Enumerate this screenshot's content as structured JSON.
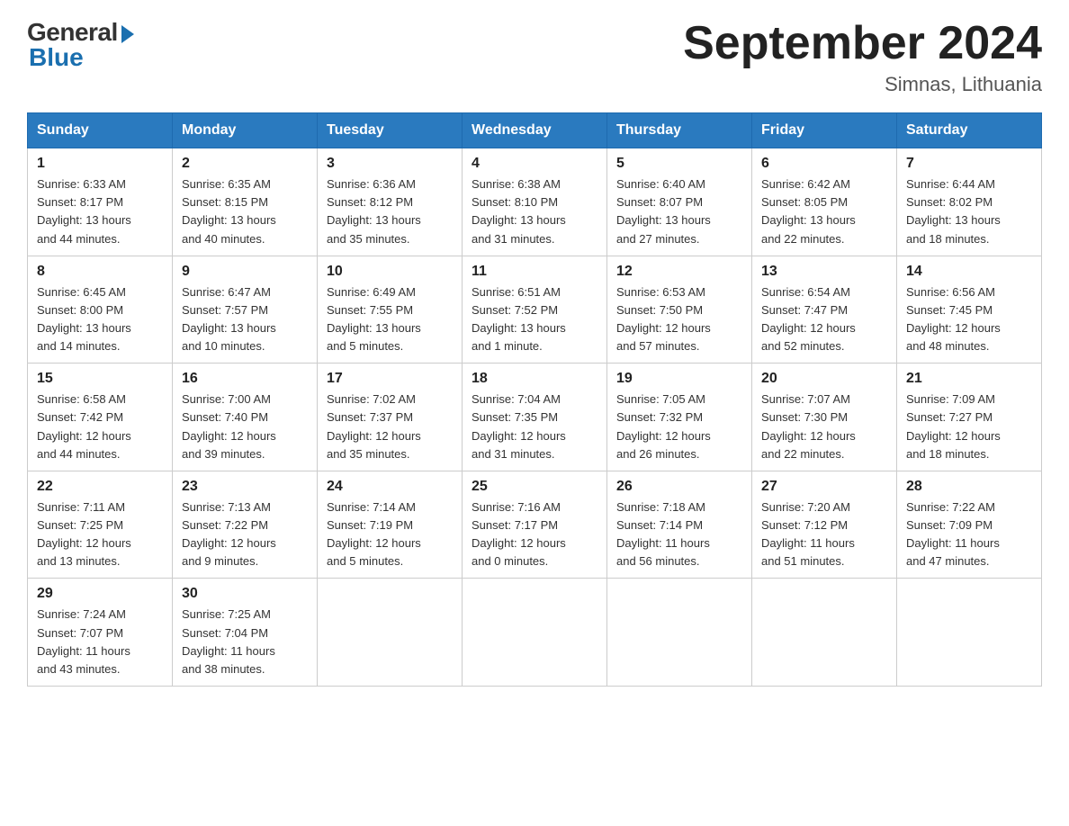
{
  "header": {
    "logo_general": "General",
    "logo_blue": "Blue",
    "month_title": "September 2024",
    "location": "Simnas, Lithuania"
  },
  "days_of_week": [
    "Sunday",
    "Monday",
    "Tuesday",
    "Wednesday",
    "Thursday",
    "Friday",
    "Saturday"
  ],
  "weeks": [
    [
      {
        "num": "1",
        "sunrise": "6:33 AM",
        "sunset": "8:17 PM",
        "daylight": "13 hours and 44 minutes."
      },
      {
        "num": "2",
        "sunrise": "6:35 AM",
        "sunset": "8:15 PM",
        "daylight": "13 hours and 40 minutes."
      },
      {
        "num": "3",
        "sunrise": "6:36 AM",
        "sunset": "8:12 PM",
        "daylight": "13 hours and 35 minutes."
      },
      {
        "num": "4",
        "sunrise": "6:38 AM",
        "sunset": "8:10 PM",
        "daylight": "13 hours and 31 minutes."
      },
      {
        "num": "5",
        "sunrise": "6:40 AM",
        "sunset": "8:07 PM",
        "daylight": "13 hours and 27 minutes."
      },
      {
        "num": "6",
        "sunrise": "6:42 AM",
        "sunset": "8:05 PM",
        "daylight": "13 hours and 22 minutes."
      },
      {
        "num": "7",
        "sunrise": "6:44 AM",
        "sunset": "8:02 PM",
        "daylight": "13 hours and 18 minutes."
      }
    ],
    [
      {
        "num": "8",
        "sunrise": "6:45 AM",
        "sunset": "8:00 PM",
        "daylight": "13 hours and 14 minutes."
      },
      {
        "num": "9",
        "sunrise": "6:47 AM",
        "sunset": "7:57 PM",
        "daylight": "13 hours and 10 minutes."
      },
      {
        "num": "10",
        "sunrise": "6:49 AM",
        "sunset": "7:55 PM",
        "daylight": "13 hours and 5 minutes."
      },
      {
        "num": "11",
        "sunrise": "6:51 AM",
        "sunset": "7:52 PM",
        "daylight": "13 hours and 1 minute."
      },
      {
        "num": "12",
        "sunrise": "6:53 AM",
        "sunset": "7:50 PM",
        "daylight": "12 hours and 57 minutes."
      },
      {
        "num": "13",
        "sunrise": "6:54 AM",
        "sunset": "7:47 PM",
        "daylight": "12 hours and 52 minutes."
      },
      {
        "num": "14",
        "sunrise": "6:56 AM",
        "sunset": "7:45 PM",
        "daylight": "12 hours and 48 minutes."
      }
    ],
    [
      {
        "num": "15",
        "sunrise": "6:58 AM",
        "sunset": "7:42 PM",
        "daylight": "12 hours and 44 minutes."
      },
      {
        "num": "16",
        "sunrise": "7:00 AM",
        "sunset": "7:40 PM",
        "daylight": "12 hours and 39 minutes."
      },
      {
        "num": "17",
        "sunrise": "7:02 AM",
        "sunset": "7:37 PM",
        "daylight": "12 hours and 35 minutes."
      },
      {
        "num": "18",
        "sunrise": "7:04 AM",
        "sunset": "7:35 PM",
        "daylight": "12 hours and 31 minutes."
      },
      {
        "num": "19",
        "sunrise": "7:05 AM",
        "sunset": "7:32 PM",
        "daylight": "12 hours and 26 minutes."
      },
      {
        "num": "20",
        "sunrise": "7:07 AM",
        "sunset": "7:30 PM",
        "daylight": "12 hours and 22 minutes."
      },
      {
        "num": "21",
        "sunrise": "7:09 AM",
        "sunset": "7:27 PM",
        "daylight": "12 hours and 18 minutes."
      }
    ],
    [
      {
        "num": "22",
        "sunrise": "7:11 AM",
        "sunset": "7:25 PM",
        "daylight": "12 hours and 13 minutes."
      },
      {
        "num": "23",
        "sunrise": "7:13 AM",
        "sunset": "7:22 PM",
        "daylight": "12 hours and 9 minutes."
      },
      {
        "num": "24",
        "sunrise": "7:14 AM",
        "sunset": "7:19 PM",
        "daylight": "12 hours and 5 minutes."
      },
      {
        "num": "25",
        "sunrise": "7:16 AM",
        "sunset": "7:17 PM",
        "daylight": "12 hours and 0 minutes."
      },
      {
        "num": "26",
        "sunrise": "7:18 AM",
        "sunset": "7:14 PM",
        "daylight": "11 hours and 56 minutes."
      },
      {
        "num": "27",
        "sunrise": "7:20 AM",
        "sunset": "7:12 PM",
        "daylight": "11 hours and 51 minutes."
      },
      {
        "num": "28",
        "sunrise": "7:22 AM",
        "sunset": "7:09 PM",
        "daylight": "11 hours and 47 minutes."
      }
    ],
    [
      {
        "num": "29",
        "sunrise": "7:24 AM",
        "sunset": "7:07 PM",
        "daylight": "11 hours and 43 minutes."
      },
      {
        "num": "30",
        "sunrise": "7:25 AM",
        "sunset": "7:04 PM",
        "daylight": "11 hours and 38 minutes."
      },
      null,
      null,
      null,
      null,
      null
    ]
  ],
  "labels": {
    "sunrise": "Sunrise:",
    "sunset": "Sunset:",
    "daylight": "Daylight:"
  }
}
